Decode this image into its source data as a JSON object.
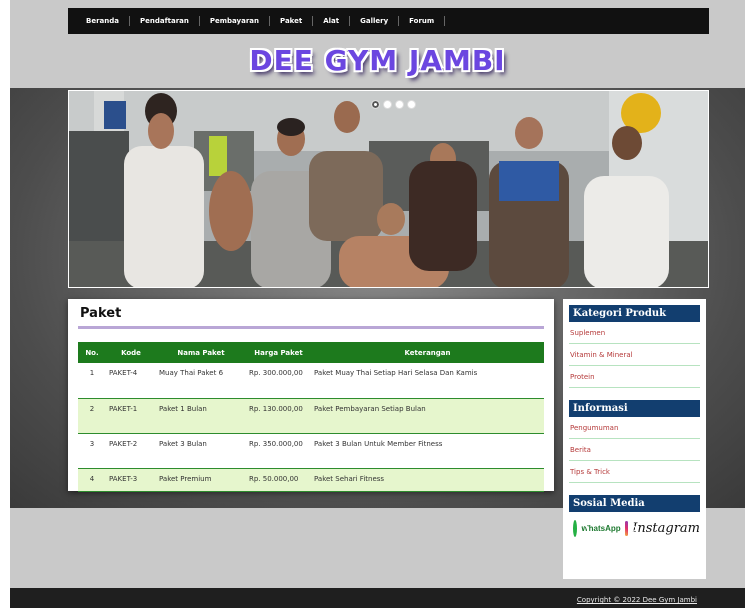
{
  "nav": {
    "items": [
      "Beranda",
      "Pendaftaran",
      "Pembayaran",
      "Paket",
      "Alat",
      "Gallery",
      "Forum"
    ]
  },
  "logo": {
    "text": "DEE GYM JAMBI"
  },
  "slider": {
    "dots": 4,
    "active_index": 0
  },
  "main": {
    "title": "Paket",
    "table": {
      "headers": [
        "No.",
        "Kode",
        "Nama Paket",
        "Harga Paket",
        "Keterangan"
      ],
      "rows": [
        {
          "no": "1",
          "kode": "PAKET-4",
          "nama": "Muay Thai Paket 6",
          "harga": "Rp. 300.000,00",
          "ket": "Paket Muay Thai Setiap Hari Selasa Dan Kamis"
        },
        {
          "no": "2",
          "kode": "PAKET-1",
          "nama": "Paket 1 Bulan",
          "harga": "Rp. 130.000,00",
          "ket": "Paket Pembayaran Setiap Bulan"
        },
        {
          "no": "3",
          "kode": "PAKET-2",
          "nama": "Paket 3 Bulan",
          "harga": "Rp. 350.000,00",
          "ket": "Paket 3 Bulan Untuk Member Fitness"
        },
        {
          "no": "4",
          "kode": "PAKET-3",
          "nama": "Paket Premium",
          "harga": "Rp. 50.000,00",
          "ket": "Paket Sehari Fitness"
        }
      ]
    }
  },
  "sidebar": {
    "kategori": {
      "title": "Kategori Produk",
      "items": [
        "Suplemen",
        "Vitamin & Mineral",
        "Protein"
      ]
    },
    "informasi": {
      "title": "Informasi",
      "items": [
        "Pengumuman",
        "Berita",
        "Tips & Trick"
      ]
    },
    "sosial": {
      "title": "Sosial Media",
      "whatsapp": "WhatsApp",
      "instagram": "Instagram"
    }
  },
  "footer": {
    "copyright": "Copyright © 2022 Dee Gym Jambi"
  },
  "colors": {
    "nav_bg": "#111111",
    "table_header": "#1d7a1d",
    "row_alt": "#e6f6cd",
    "side_head": "#123e6f",
    "logo": "#6b46e0"
  }
}
